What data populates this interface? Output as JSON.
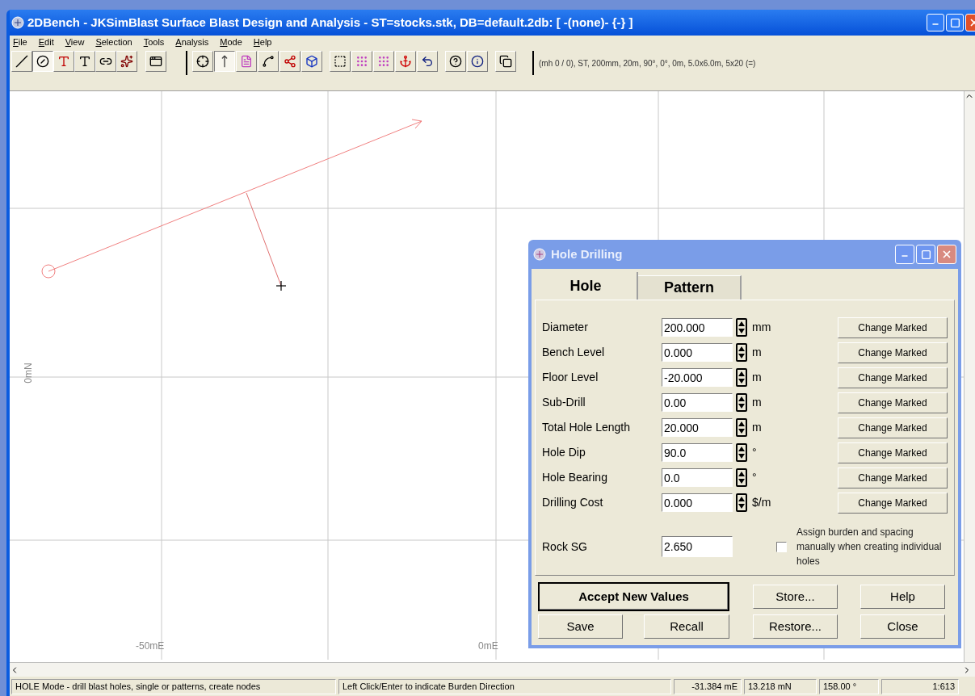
{
  "window": {
    "title": "2DBench - JKSimBlast Surface Blast Design and Analysis - ST=stocks.stk, DB=default.2db: [ -(none)- {-} ]"
  },
  "menu": [
    "File",
    "Edit",
    "View",
    "Selection",
    "Tools",
    "Analysis",
    "Mode",
    "Help"
  ],
  "toolbar": {
    "drawing_tools": [
      {
        "selected": false
      },
      {
        "selected": true
      },
      {
        "selected": false
      },
      {
        "selected": false
      },
      {
        "selected": false
      },
      {
        "selected": false
      }
    ],
    "mode_tools": [
      {
        "selected": false
      },
      {
        "selected": true
      },
      {
        "selected": false
      },
      {
        "selected": false
      },
      {
        "selected": false
      },
      {
        "selected": false
      },
      {
        "selected": false
      },
      {
        "selected": false
      },
      {
        "selected": false
      },
      {
        "selected": false
      },
      {
        "selected": false
      },
      {
        "selected": false
      },
      {
        "selected": false
      },
      {
        "selected": false
      }
    ],
    "readout": "(mh 0 / 0), ST, 200mm, 20m, 90°, 0°, 0m, 5.0x6.0m, 5x20 (=)"
  },
  "canvas": {
    "y_axis_label": "0mN",
    "x_axis_labels": [
      "-50mE",
      "0mE"
    ]
  },
  "dialog": {
    "title": "Hole Drilling",
    "tabs": [
      {
        "label": "Hole",
        "selected": true
      },
      {
        "label": "Pattern",
        "selected": false
      }
    ],
    "fields": [
      {
        "label": "Diameter",
        "value": "200.000",
        "unit": "mm",
        "button": "Change Marked"
      },
      {
        "label": "Bench Level",
        "value": "0.000",
        "unit": "m",
        "button": "Change Marked"
      },
      {
        "label": "Floor Level",
        "value": "-20.000",
        "unit": "m",
        "button": "Change Marked"
      },
      {
        "label": "Sub-Drill",
        "value": "0.00",
        "unit": "m",
        "button": "Change Marked"
      },
      {
        "label": "Total Hole Length",
        "value": "20.000",
        "unit": "m",
        "button": "Change Marked"
      },
      {
        "label": "Hole Dip",
        "value": "90.0",
        "unit": "°",
        "button": "Change Marked"
      },
      {
        "label": "Hole Bearing",
        "value": "0.0",
        "unit": "°",
        "button": "Change Marked"
      },
      {
        "label": "Drilling Cost",
        "value": "0.000",
        "unit": "$/m",
        "button": "Change Marked"
      }
    ],
    "rock_sg": {
      "label": "Rock SG",
      "value": "2.650"
    },
    "manual_checkbox": {
      "label": "Assign burden and spacing manually when creating individual holes",
      "checked": false
    },
    "buttons": [
      {
        "label": "Accept New Values",
        "default": true
      },
      {
        "label": "Store...",
        "default": false
      },
      {
        "label": "Help",
        "default": false
      },
      {
        "label": "Save",
        "default": false
      },
      {
        "label": "Recall",
        "default": false
      },
      {
        "label": "Restore...",
        "default": false
      },
      {
        "label": "Close",
        "default": false
      }
    ]
  },
  "status_bar": [
    "HOLE Mode - drill blast holes, single or patterns, create nodes",
    "Left Click/Enter to indicate Burden Direction",
    "-31.384 mE",
    "13.218 mN",
    "158.00 °",
    "1:613"
  ]
}
